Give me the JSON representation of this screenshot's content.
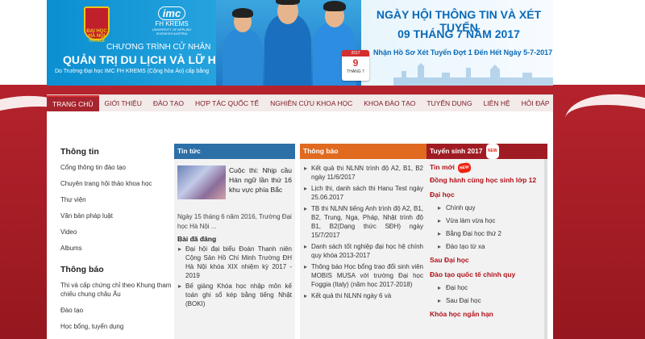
{
  "banner": {
    "hanu_logo_text": "ĐẠI HỌC HÀ NỘI HANOI",
    "imc_logo": "imc",
    "imc_name": "FH KREMS",
    "imc_sub": "UNIVERSITY OF APPLIED SCIENCES AUSTRIA",
    "program_label": "CHƯƠNG TRÌNH CỬ NHÂN",
    "program_title": "QUẢN TRỊ DU LỊCH VÀ LỮ HÀNH",
    "program_sub": "Do Trường Đại học IMC FH KREMS (Cộng hòa Áo) cấp bằng",
    "event_title": "NGÀY HỘI THÔNG TIN VÀ XÉT TUYỂN",
    "event_date": "09 THÁNG 7 NĂM 2017",
    "notice": "Nhận Hồ Sơ Xét Tuyển Đợt 1 Đến Hết Ngày 5-7-2017",
    "calendar": {
      "year": "2017",
      "day": "9",
      "month": "THÁNG 7"
    }
  },
  "nav": [
    "TRANG CHỦ",
    "GIỚI THIỆU",
    "ĐÀO TẠO",
    "HỢP TÁC QUỐC TẾ",
    "NGHIÊN CỨU KHOA HỌC",
    "KHOA ĐÀO TẠO",
    "TUYỂN DỤNG",
    "LIÊN HỆ",
    "HỎI ĐÁP"
  ],
  "sidebar": {
    "info_title": "Thông tin",
    "info_items": [
      "Cổng thông tin đào tạo",
      "Chuyên trang hội thảo khoa học",
      "Thư viện",
      "Văn bản pháp luật",
      "Video",
      "Albums"
    ],
    "notice_title": "Thông báo",
    "notice_items": [
      "Thi và cấp chứng chỉ theo Khung tham chiếu chung châu Âu",
      "Đào tạo",
      "Học bổng, tuyển dụng"
    ]
  },
  "news": {
    "header": "Tin tức",
    "headline": "Cuộc thi: Nhịp cầu Hán ngữ lần thứ 16 khu vực phía Bắc",
    "summary": "Ngày 15 tháng 6 năm 2016, Trường Đại học Hà Nội ...",
    "posted_title": "Bài đã đăng",
    "posted": [
      "Đại hội đại biểu Đoàn Thanh niên Cộng Sản Hồ Chí Minh Trường ĐH Hà Nội khóa XIX nhiệm kỳ 2017 - 2019",
      "Bế giảng Khóa học nhập môn kế toán ghi sổ kép bằng tiếng Nhật (BOKI)"
    ]
  },
  "announcements": {
    "header": "Thông báo",
    "items": [
      "Kết quả thi NLNN trình độ A2, B1, B2 ngày 11/6/2017",
      "Lịch thi, danh sách thi Hanu Test ngày 25.06.2017",
      "TB thi NLNN tiếng Anh trình độ A2, B1, B2, Trung, Nga, Pháp, Nhật trình độ B1, B2(Dạng thức SĐH) ngày 15/7/2017",
      "Danh sách tốt nghiệp đại học hệ chính quy khóa 2013-2017",
      "Thông báo Học bổng trao đổi sinh viên MOBIS MUSA với trường Đại học Foggia (Italy) (năm học 2017-2018)",
      "Kết quả thi NLNN ngày 6 và"
    ]
  },
  "admissions": {
    "header": "Tuyển sinh 2017",
    "badge": "NEW",
    "new_label": "Tin mới",
    "new_highlight": "Đồng hành cùng học sinh lớp 12",
    "undergrad": "Đại học",
    "undergrad_items": [
      "Chính quy",
      "Vừa làm vừa học",
      "Bằng Đại học thứ 2",
      "Đào tạo từ xa"
    ],
    "postgrad": "Sau Đại học",
    "intl": "Đào tạo quốc tế chính quy",
    "intl_items": [
      "Đại học",
      "Sau Đại học"
    ],
    "short": "Khóa học ngắn hạn"
  }
}
